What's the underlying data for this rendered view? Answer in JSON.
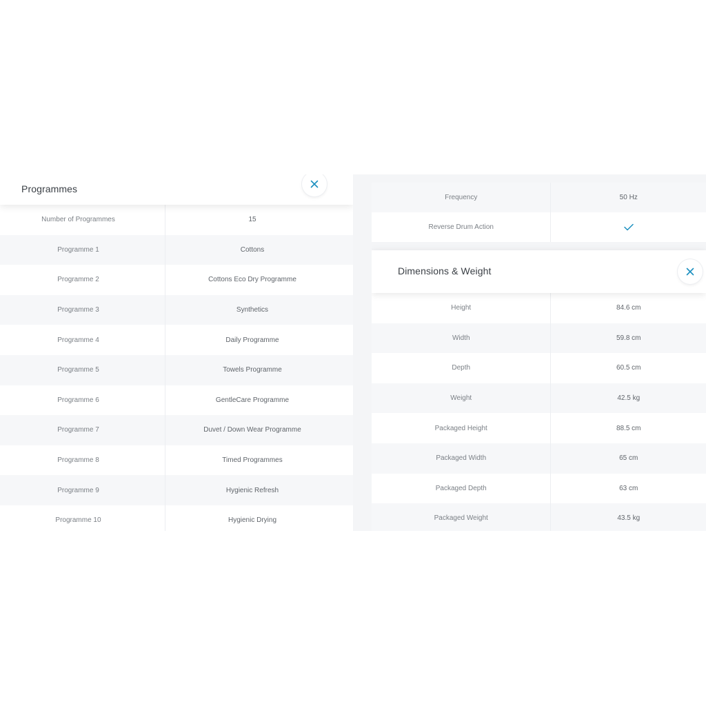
{
  "programmes": {
    "title": "Programmes",
    "rows": [
      {
        "label": "Number of Programmes",
        "value": "15"
      },
      {
        "label": "Programme 1",
        "value": "Cottons"
      },
      {
        "label": "Programme 2",
        "value": "Cottons Eco Dry Programme"
      },
      {
        "label": "Programme 3",
        "value": "Synthetics"
      },
      {
        "label": "Programme 4",
        "value": "Daily Programme"
      },
      {
        "label": "Programme 5",
        "value": "Towels Programme"
      },
      {
        "label": "Programme 6",
        "value": "GentleCare Programme"
      },
      {
        "label": "Programme 7",
        "value": "Duvet / Down Wear Programme"
      },
      {
        "label": "Programme 8",
        "value": "Timed Programmes"
      },
      {
        "label": "Programme 9",
        "value": "Hygienic Refresh"
      },
      {
        "label": "Programme 10",
        "value": "Hygienic Drying"
      }
    ]
  },
  "electrical": {
    "rows": [
      {
        "label": "Frequency",
        "value": "50 Hz"
      },
      {
        "label": "Reverse Drum Action",
        "value": "",
        "icon": "checkmark-icon"
      }
    ]
  },
  "dimensions": {
    "title": "Dimensions & Weight",
    "rows": [
      {
        "label": "Height",
        "value": "84.6 cm"
      },
      {
        "label": "Width",
        "value": "59.8 cm"
      },
      {
        "label": "Depth",
        "value": "60.5 cm"
      },
      {
        "label": "Weight",
        "value": "42.5 kg"
      },
      {
        "label": "Packaged Height",
        "value": "88.5 cm"
      },
      {
        "label": "Packaged Width",
        "value": "65 cm"
      },
      {
        "label": "Packaged Depth",
        "value": "63 cm"
      },
      {
        "label": "Packaged Weight",
        "value": "43.5 kg"
      }
    ]
  },
  "icons": {
    "close": "close-icon",
    "check": "checkmark-icon"
  },
  "colors": {
    "accent": "#1a8fbf",
    "row_alt": "#f6f7f9",
    "divider": "#eceef1",
    "title_text": "#3a3f45",
    "cell_text": "#7a7f85"
  }
}
